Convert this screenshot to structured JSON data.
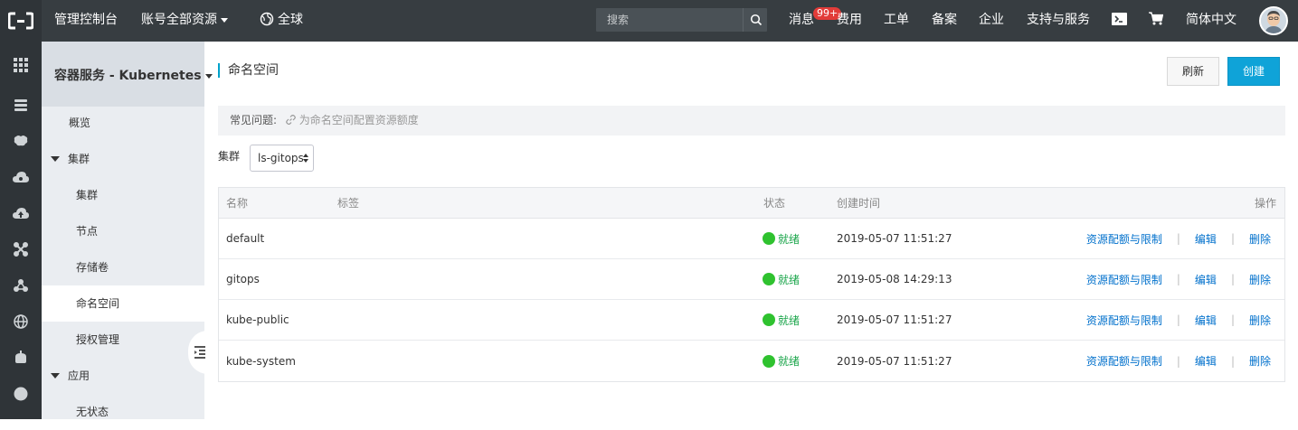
{
  "topbar": {
    "console": "管理控制台",
    "account": "账号全部资源",
    "region": "全球",
    "search_placeholder": "搜索",
    "messages": "消息",
    "messages_badge": "99+",
    "billing": "费用",
    "tickets": "工单",
    "icp": "备案",
    "enterprise": "企业",
    "support": "支持与服务",
    "language": "简体中文"
  },
  "rail": {
    "icons": [
      "grid-icon",
      "database-icon",
      "brain-icon",
      "cloud-settings-icon",
      "cloud-upload-icon",
      "network-icon",
      "cluster-icon",
      "globe-icon",
      "monitor-icon",
      "circle-icon"
    ]
  },
  "sidebar": {
    "title": "容器服务 - Kubernetes",
    "items": [
      {
        "label": "概览"
      },
      {
        "label": "集群"
      },
      {
        "label": "集群"
      },
      {
        "label": "节点"
      },
      {
        "label": "存储卷"
      },
      {
        "label": "命名空间"
      },
      {
        "label": "授权管理"
      },
      {
        "label": "应用"
      },
      {
        "label": "无状态"
      }
    ]
  },
  "main": {
    "title": "命名空间",
    "refresh": "刷新",
    "create": "创建",
    "faq_label": "常见问题:",
    "faq_link": "为命名空间配置资源额度",
    "cluster_label": "集群",
    "cluster_value": "ls-gitops"
  },
  "table": {
    "headers": {
      "name": "名称",
      "labels": "标签",
      "status": "状态",
      "created": "创建时间",
      "actions": "操作"
    },
    "rows": [
      {
        "name": "default",
        "status": "就绪",
        "created": "2019-05-07 11:51:27",
        "quota": "资源配额与限制",
        "edit": "编辑",
        "delete": "删除"
      },
      {
        "name": "gitops",
        "status": "就绪",
        "created": "2019-05-08 14:29:13",
        "quota": "资源配额与限制",
        "edit": "编辑",
        "delete": "删除"
      },
      {
        "name": "kube-public",
        "status": "就绪",
        "created": "2019-05-07 11:51:27",
        "quota": "资源配额与限制",
        "edit": "编辑",
        "delete": "删除"
      },
      {
        "name": "kube-system",
        "status": "就绪",
        "created": "2019-05-07 11:51:27",
        "quota": "资源配额与限制",
        "edit": "编辑",
        "delete": "删除"
      }
    ]
  },
  "colors": {
    "topbar": "#373d41",
    "accent": "#0fa3d8",
    "status_ok": "#2fc22f",
    "link": "#0070cc"
  }
}
